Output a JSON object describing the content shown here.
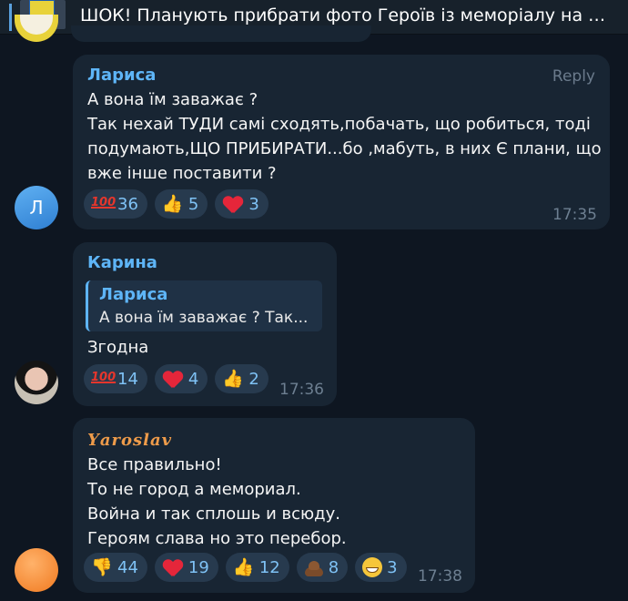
{
  "header": {
    "pinned_text": "ШОК! Планують прибрати фото Героїв із меморіалу на Бульв..."
  },
  "messages": [
    {
      "author": "Лариса",
      "avatar_letter": "Л",
      "reply_label": "Reply",
      "text": "А вона їм заважає ?\nТак нехай ТУДИ самі сходять,побачать, що робиться, тоді\nподумають,ЩО ПРИБИРАТИ...бо ,мабуть, в них Є плани, що\nвже інше поставити ?",
      "reactions": [
        {
          "emoji": "hundred-points",
          "count": "36"
        },
        {
          "emoji": "thumbs-up",
          "count": "5"
        },
        {
          "emoji": "red-heart",
          "count": "3"
        }
      ],
      "time": "17:35"
    },
    {
      "author": "Карина",
      "quote": {
        "author": "Лариса",
        "text": "А вона їм заважає ? Так..."
      },
      "text": "Згодна",
      "reactions": [
        {
          "emoji": "hundred-points",
          "count": "14"
        },
        {
          "emoji": "red-heart",
          "count": "4"
        },
        {
          "emoji": "thumbs-up",
          "count": "2"
        }
      ],
      "time": "17:36"
    },
    {
      "author": "𝒀𝒂𝒓𝒐𝒔𝒍𝒂𝒗",
      "text": "Все правильно!\nТо не город а мемориал.\nВойна и так сплошь и всюду.\nГероям слава но это перебор.",
      "reactions": [
        {
          "emoji": "thumbs-down",
          "count": "44"
        },
        {
          "emoji": "red-heart",
          "count": "19"
        },
        {
          "emoji": "thumbs-up",
          "count": "12"
        },
        {
          "emoji": "pile-of-poo",
          "count": "8"
        },
        {
          "emoji": "grinning-face",
          "count": "3"
        }
      ],
      "time": "17:38"
    }
  ],
  "emoji_glyphs": {
    "hundred": "100",
    "thumbs_up": "👍",
    "thumbs_down": "👎"
  },
  "colors": {
    "background": "#0e1621",
    "bubble": "#182533",
    "accent": "#5eb5f7",
    "reaction": "#273a4e"
  }
}
